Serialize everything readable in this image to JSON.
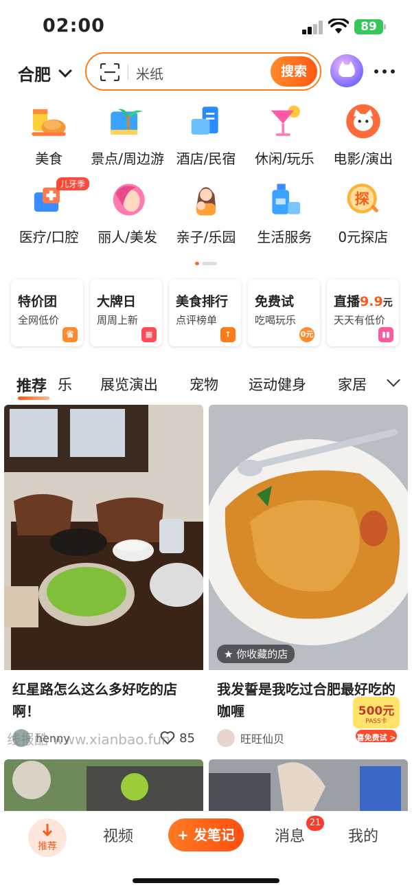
{
  "status": {
    "time": "02:00",
    "battery": "89"
  },
  "header": {
    "city": "合肥",
    "search_placeholder": "米纸",
    "search_button": "搜索"
  },
  "categories": [
    {
      "label": "美食",
      "icon": "food-icon"
    },
    {
      "label": "景点/周边游",
      "icon": "scenic-icon"
    },
    {
      "label": "酒店/民宿",
      "icon": "hotel-icon"
    },
    {
      "label": "休闲/玩乐",
      "icon": "cocktail-icon"
    },
    {
      "label": "电影/演出",
      "icon": "movie-cat-icon"
    },
    {
      "label": "医疗/口腔",
      "icon": "medical-icon",
      "badge": "儿牙季"
    },
    {
      "label": "丽人/美发",
      "icon": "beauty-icon"
    },
    {
      "label": "亲子/乐园",
      "icon": "parent-child-icon"
    },
    {
      "label": "生活服务",
      "icon": "life-service-icon"
    },
    {
      "label": "0元探店",
      "icon": "explore-icon"
    }
  ],
  "promos": [
    {
      "title": "特价团",
      "sub": "全网低价",
      "icon_text": "省"
    },
    {
      "title": "大牌日",
      "sub": "周周上新",
      "icon_text": ""
    },
    {
      "title": "美食排行",
      "sub": "点评榜单",
      "icon_text": "↑"
    },
    {
      "title": "免费试",
      "sub": "吃喝玩乐",
      "icon_text": "0元"
    },
    {
      "title": "直播",
      "title_hl": "9.9",
      "title_unit": "元",
      "sub": "天天有低价",
      "icon_text": ""
    }
  ],
  "tabs": [
    "推荐",
    "乐",
    "展览演出",
    "宠物",
    "运动健身",
    "家居"
  ],
  "feed": [
    {
      "title": "红星路怎么这么多好吃的店啊！",
      "user": "henny",
      "likes": "85"
    },
    {
      "title": "我发誓是我吃过合肥最好吃的咖喱",
      "user": "旺旺仙贝",
      "fav_tag": "你收藏的店"
    }
  ],
  "coupon": {
    "amount": "500元",
    "sub": "PASS卡",
    "cta": "喜免费试 >"
  },
  "watermark": "线报酷 www.xianbao.fun",
  "bottom_nav": {
    "home": "推荐",
    "video": "视频",
    "post": "+ 发笔记",
    "messages": "消息",
    "messages_badge": "21",
    "me": "我的"
  }
}
